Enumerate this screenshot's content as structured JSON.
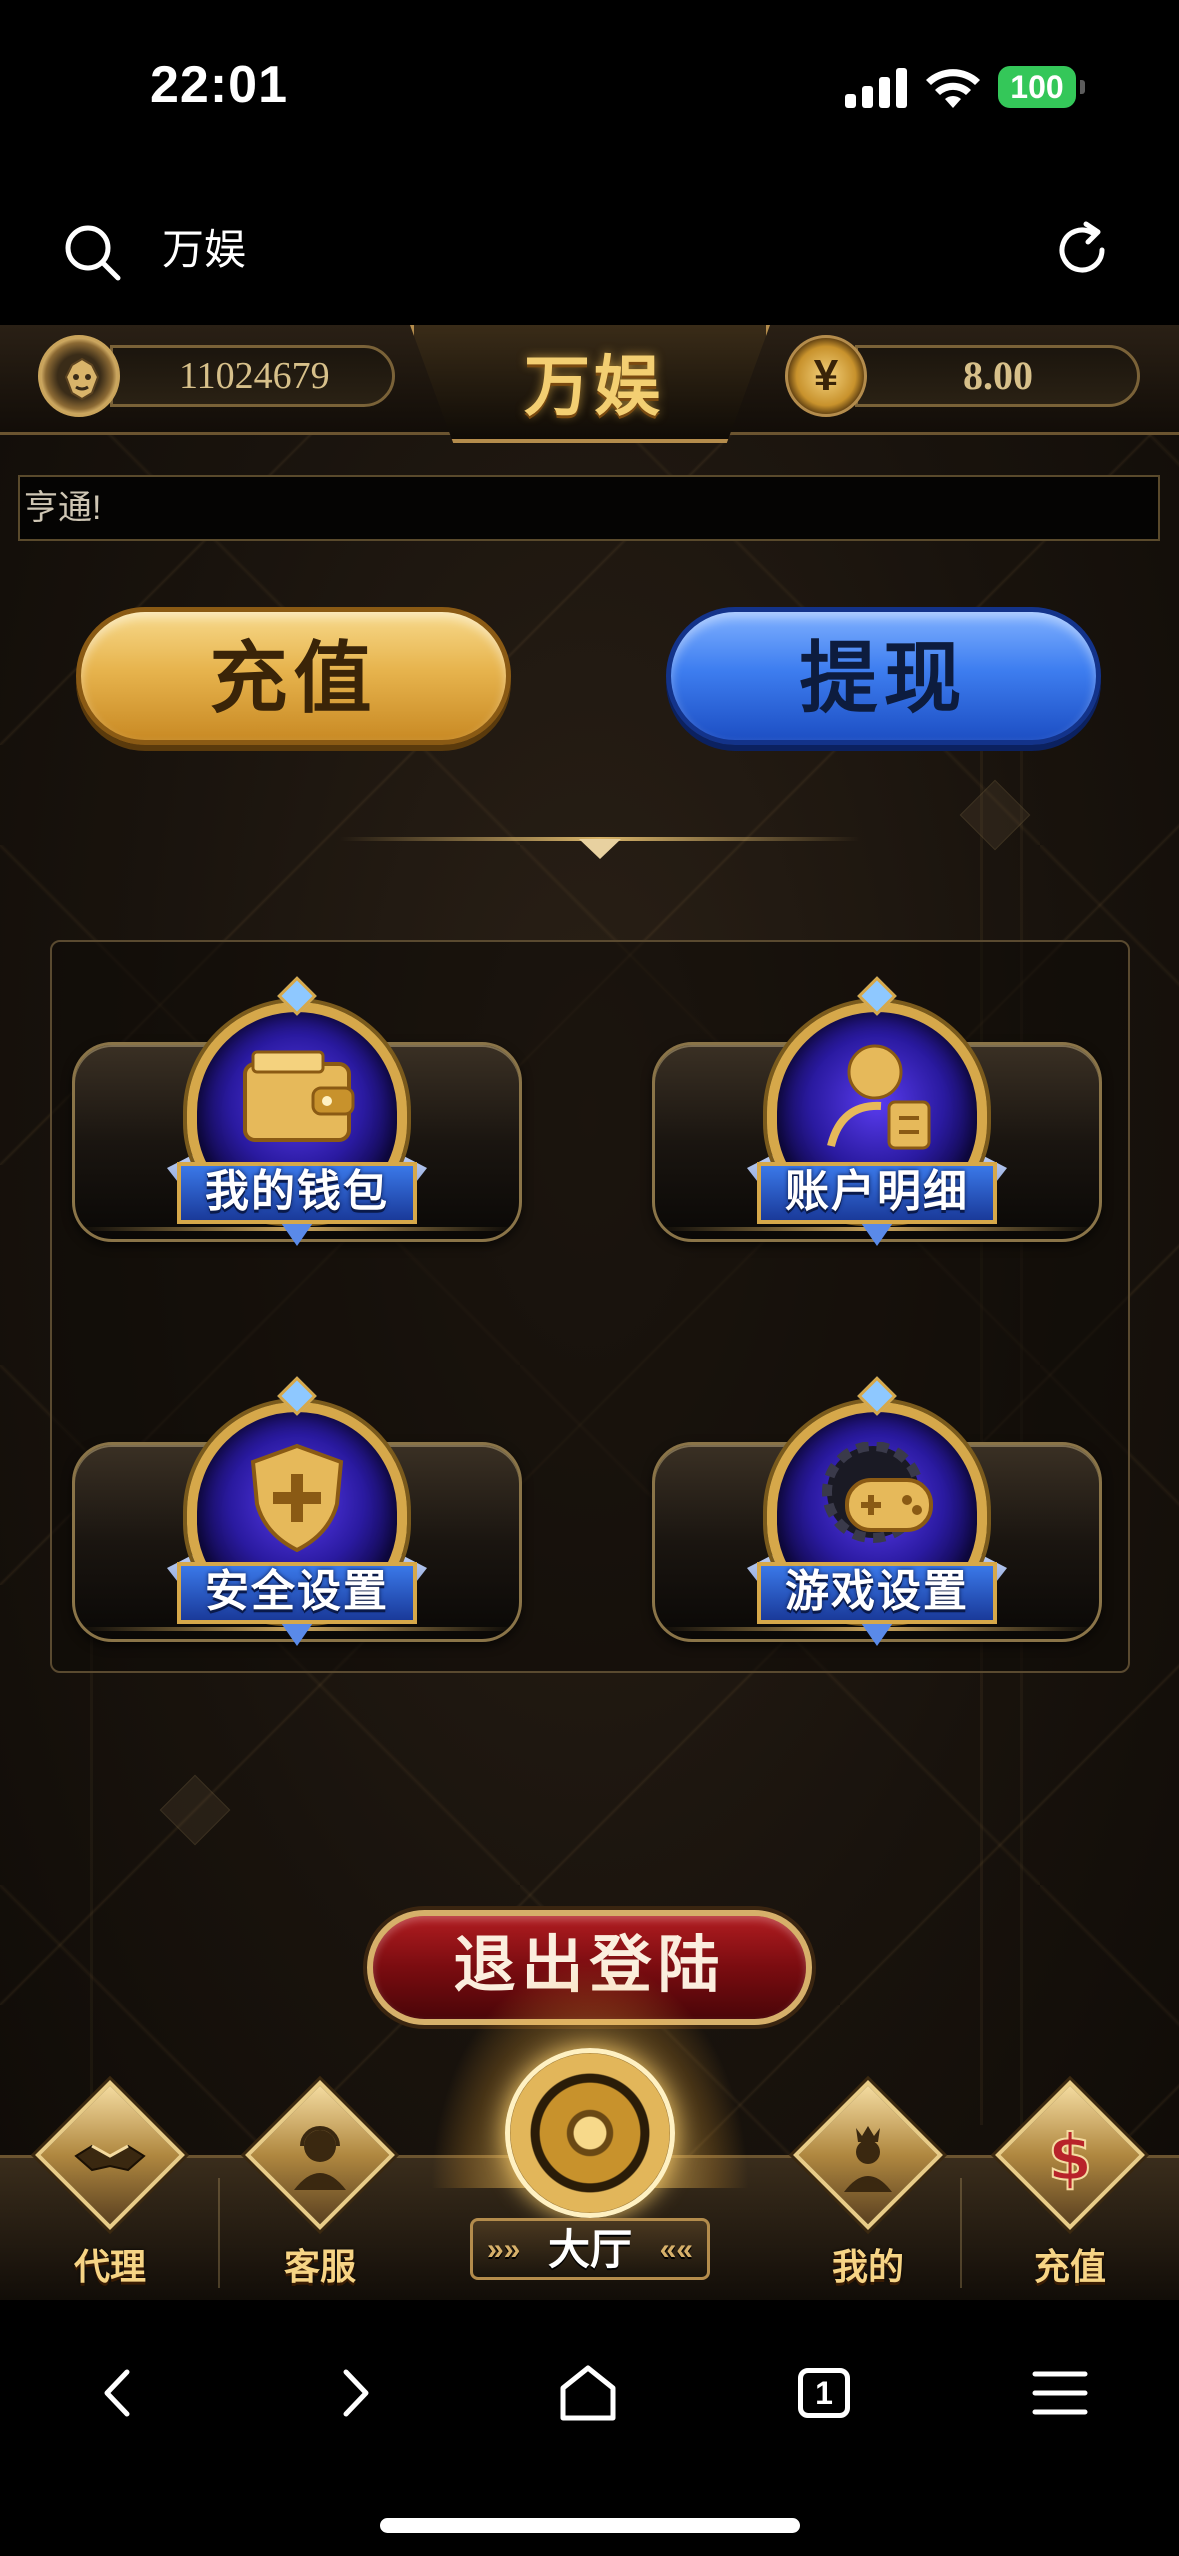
{
  "status_bar": {
    "time": "22:01",
    "battery": "100"
  },
  "browser": {
    "title": "万娱"
  },
  "header": {
    "user_id": "11024679",
    "logo": "万娱",
    "currency_icon": "¥",
    "balance": "8.00"
  },
  "marquee": {
    "text": "亨通!"
  },
  "actions": {
    "recharge_label": "充值",
    "withdraw_label": "提现"
  },
  "menu": {
    "items": [
      {
        "label": "我的钱包",
        "icon": "wallet-icon"
      },
      {
        "label": "账户明细",
        "icon": "account-details-icon"
      },
      {
        "label": "安全设置",
        "icon": "security-shield-icon"
      },
      {
        "label": "游戏设置",
        "icon": "gamepad-gear-icon"
      }
    ]
  },
  "logout": {
    "label": "退出登陆"
  },
  "bottom_nav": {
    "items": [
      {
        "label": "代理",
        "icon": "handshake-icon"
      },
      {
        "label": "客服",
        "icon": "support-agent-icon"
      },
      {
        "label": "大厅",
        "icon": "roulette-icon"
      },
      {
        "label": "我的",
        "icon": "profile-icon"
      },
      {
        "label": "充值",
        "icon": "dollar-icon"
      }
    ]
  },
  "browser_toolbar": {
    "tab_count": "1"
  },
  "colors": {
    "gold": "#d6b06a",
    "dark_bg": "#19130d",
    "blue": "#3e7ef0",
    "red": "#7a0c10"
  }
}
